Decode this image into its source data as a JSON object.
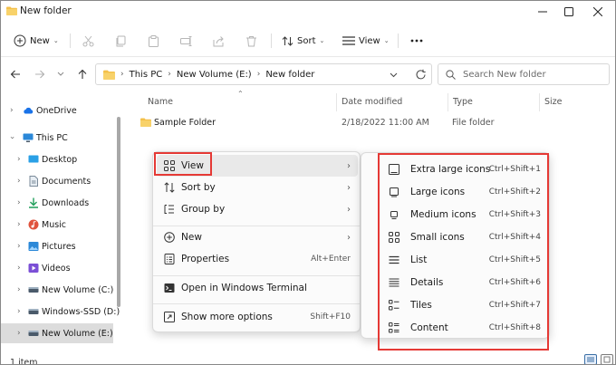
{
  "window": {
    "title": "New folder",
    "controls": [
      "minimize",
      "maximize",
      "close"
    ]
  },
  "toolbar": {
    "new_label": "New",
    "sort_label": "Sort",
    "view_label": "View",
    "more": "more-options",
    "disabled_icons": [
      "cut-icon",
      "copy-icon",
      "paste-icon",
      "rename-icon",
      "share-icon",
      "delete-icon"
    ]
  },
  "address": {
    "segments": [
      "This PC",
      "New Volume (E:)",
      "New folder"
    ],
    "search_placeholder": "Search New folder"
  },
  "nav_pane": {
    "items": [
      {
        "label": "OneDrive",
        "icon": "cloud-icon",
        "color": "#1a73e8"
      },
      {
        "label": "This PC",
        "icon": "pc-icon",
        "color": "#2b88d8"
      },
      {
        "label": "Desktop",
        "icon": "desktop-icon",
        "color": "#2aa0e6"
      },
      {
        "label": "Documents",
        "icon": "documents-icon",
        "color": "#7a8a99"
      },
      {
        "label": "Downloads",
        "icon": "downloads-icon",
        "color": "#1f9e5a"
      },
      {
        "label": "Music",
        "icon": "music-icon",
        "color": "#e0533d"
      },
      {
        "label": "Pictures",
        "icon": "pictures-icon",
        "color": "#2b88d8"
      },
      {
        "label": "Videos",
        "icon": "videos-icon",
        "color": "#7b4fd6"
      },
      {
        "label": "New Volume (C:)",
        "icon": "drive-icon",
        "color": "#4a5a6a"
      },
      {
        "label": "Windows-SSD (D:)",
        "icon": "drive-icon",
        "color": "#4a5a6a"
      },
      {
        "label": "New Volume (E:)",
        "icon": "drive-icon",
        "color": "#4a5a6a"
      }
    ]
  },
  "file_list": {
    "columns": [
      "Name",
      "Date modified",
      "Type",
      "Size"
    ],
    "rows": [
      {
        "name": "Sample Folder",
        "date": "2/18/2022 11:00 AM",
        "type": "File folder",
        "size": ""
      }
    ]
  },
  "status": {
    "items": "1 item"
  },
  "context_menu": {
    "items": [
      {
        "label": "View",
        "icon": "view-icon",
        "arrow": "›"
      },
      {
        "label": "Sort by",
        "icon": "sort-icon",
        "arrow": "›"
      },
      {
        "label": "Group by",
        "icon": "group-icon",
        "arrow": "›"
      },
      {
        "label": "New",
        "icon": "new-icon",
        "arrow": "›"
      },
      {
        "label": "Properties",
        "icon": "properties-icon",
        "shortcut": "Alt+Enter"
      },
      {
        "label": "Open in Windows Terminal",
        "icon": "terminal-icon"
      },
      {
        "label": "Show more options",
        "icon": "more-options-icon",
        "shortcut": "Shift+F10"
      }
    ]
  },
  "view_submenu": {
    "items": [
      {
        "label": "Extra large icons",
        "shortcut": "Ctrl+Shift+1",
        "icon": "extra-large-icons-icon"
      },
      {
        "label": "Large icons",
        "shortcut": "Ctrl+Shift+2",
        "icon": "large-icons-icon"
      },
      {
        "label": "Medium icons",
        "shortcut": "Ctrl+Shift+3",
        "icon": "medium-icons-icon"
      },
      {
        "label": "Small icons",
        "shortcut": "Ctrl+Shift+4",
        "icon": "small-icons-icon"
      },
      {
        "label": "List",
        "shortcut": "Ctrl+Shift+5",
        "icon": "list-icon"
      },
      {
        "label": "Details",
        "shortcut": "Ctrl+Shift+6",
        "icon": "details-icon"
      },
      {
        "label": "Tiles",
        "shortcut": "Ctrl+Shift+7",
        "icon": "tiles-icon"
      },
      {
        "label": "Content",
        "shortcut": "Ctrl+Shift+8",
        "icon": "content-icon"
      }
    ]
  },
  "colors": {
    "highlight_box": "#e53935",
    "folder_yellow": "#f4c04a"
  }
}
